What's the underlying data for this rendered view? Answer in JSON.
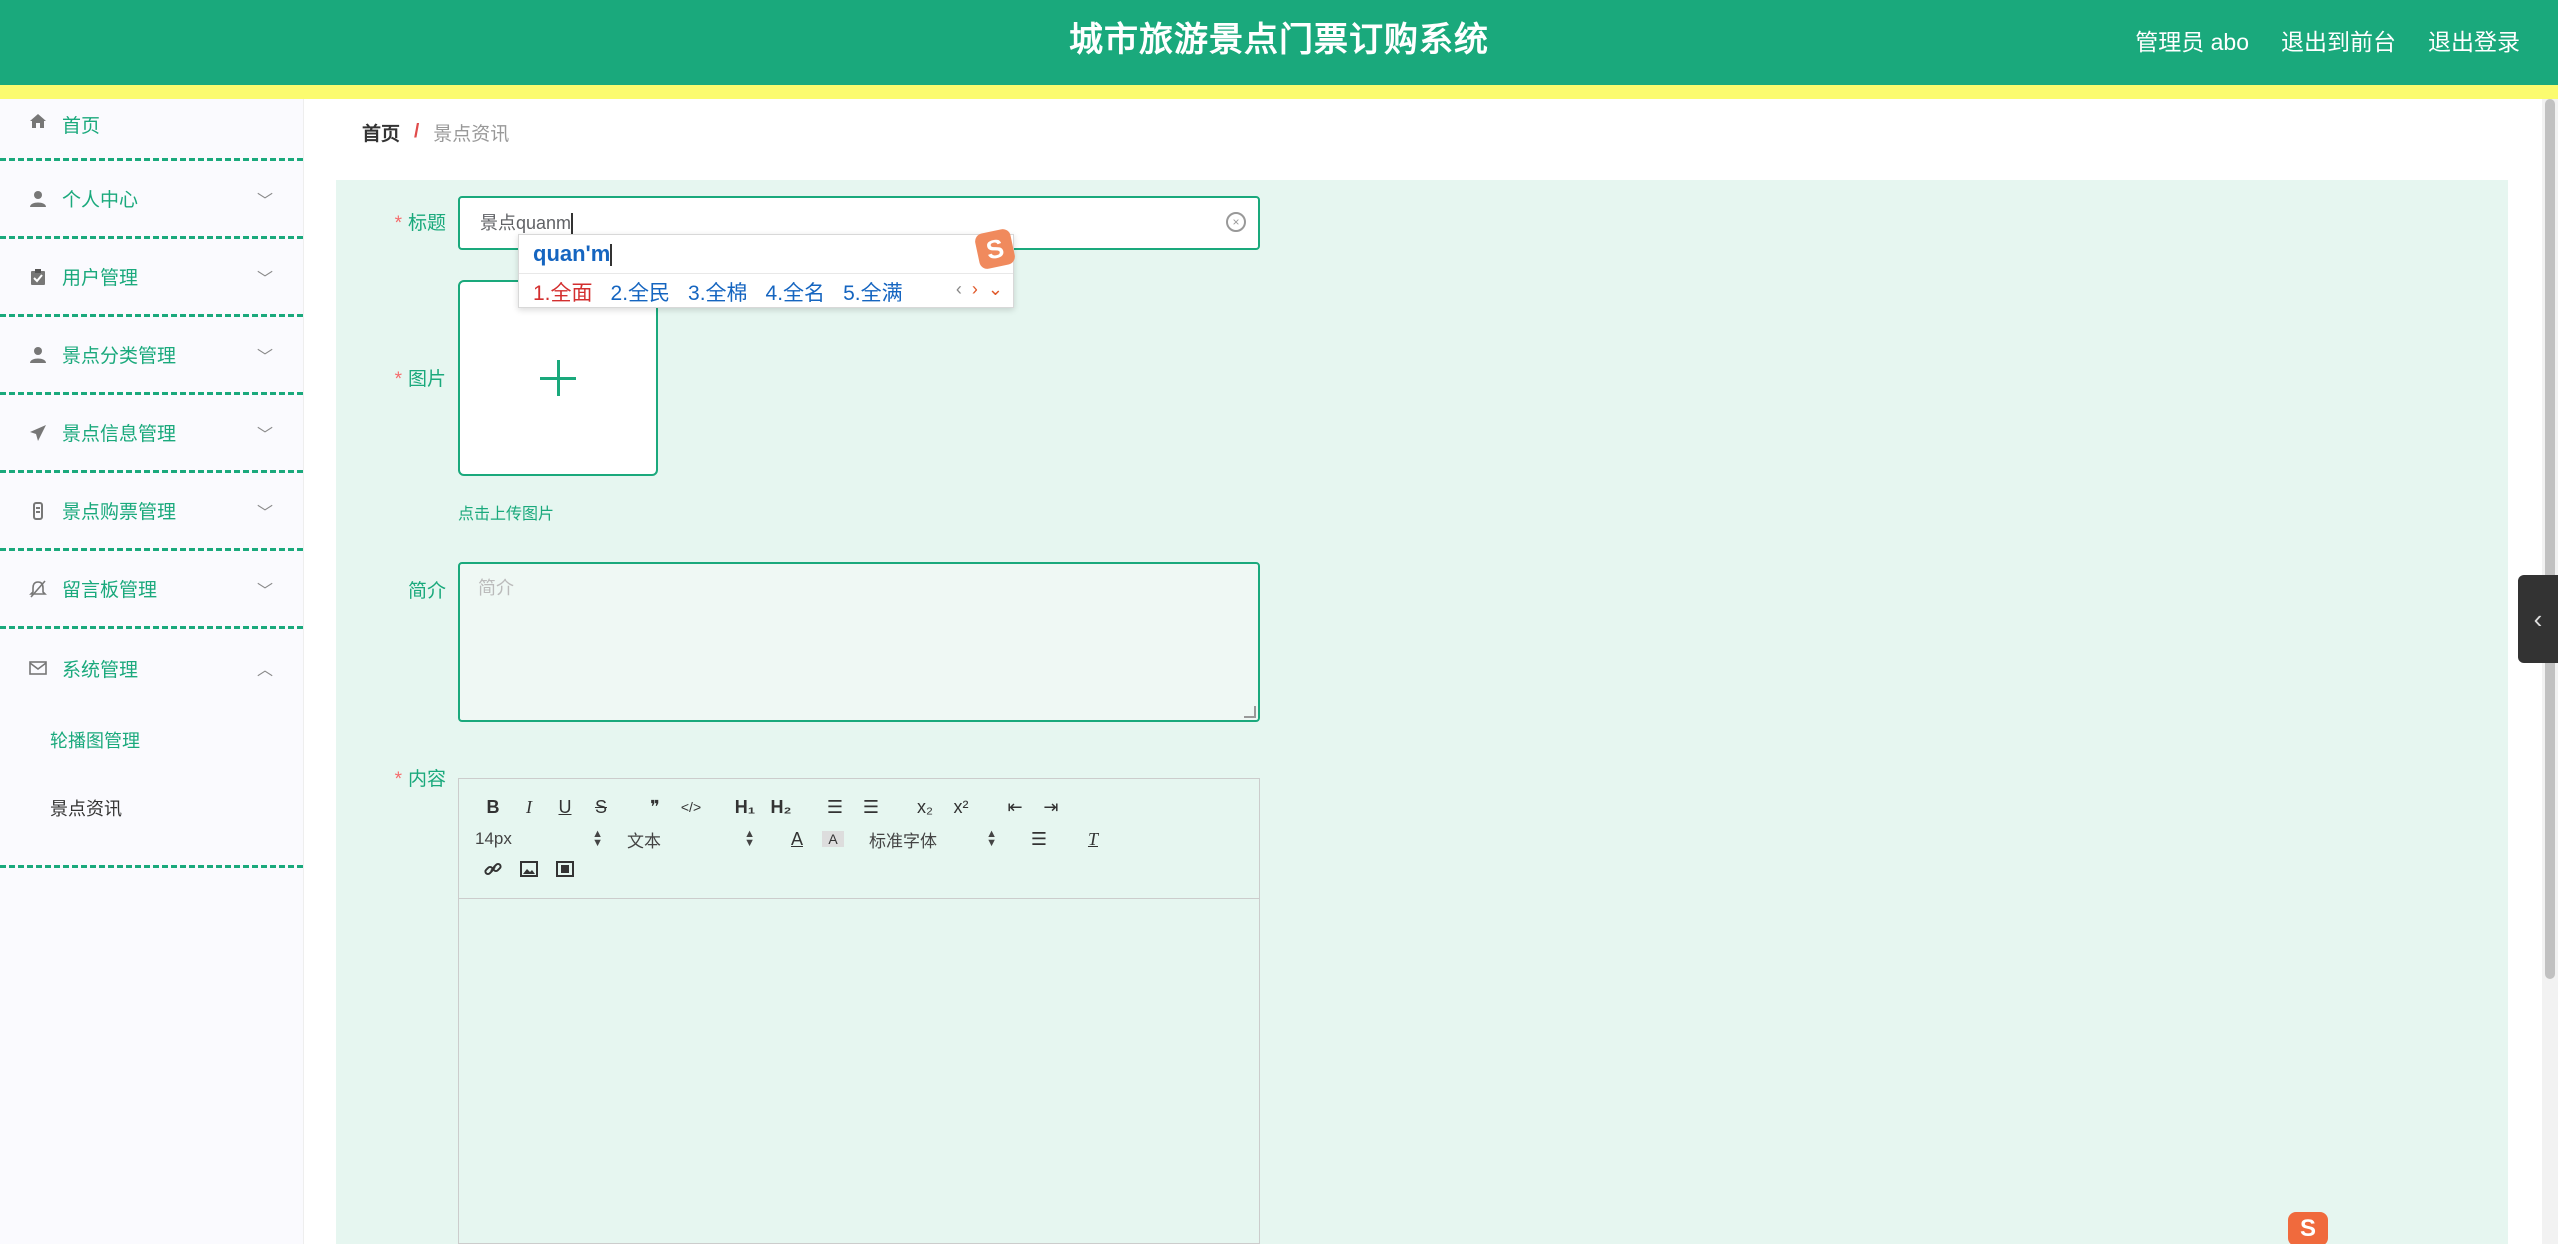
{
  "header": {
    "title": "城市旅游景点门票订购系统",
    "user_label": "管理员 abo",
    "to_front": "退出到前台",
    "logout": "退出登录"
  },
  "sidebar": {
    "items": [
      {
        "label": "首页",
        "icon": "home-icon"
      },
      {
        "label": "个人中心",
        "icon": "user-icon"
      },
      {
        "label": "用户管理",
        "icon": "clipboard-icon"
      },
      {
        "label": "景点分类管理",
        "icon": "person-icon"
      },
      {
        "label": "景点信息管理",
        "icon": "paper-plane-icon"
      },
      {
        "label": "景点购票管理",
        "icon": "ticket-icon"
      },
      {
        "label": "留言板管理",
        "icon": "bell-off-icon"
      },
      {
        "label": "系统管理",
        "icon": "mail-icon"
      }
    ],
    "sub_items": [
      "轮播图管理",
      "景点资讯"
    ]
  },
  "breadcrumb": {
    "home": "首页",
    "separator": "/",
    "current": "景点资讯"
  },
  "form": {
    "title_label": "标题",
    "title_value": "景点quanm",
    "image_label": "图片",
    "upload_hint": "点击上传图片",
    "intro_label": "简介",
    "intro_placeholder": "简介",
    "content_label": "内容"
  },
  "editor": {
    "buttons_row1": [
      "B",
      "I",
      "U",
      "S",
      "❞",
      "</>",
      "H₁",
      "H₂",
      "☰",
      "☰",
      "x₂",
      "x²",
      "⇤",
      "⇥"
    ],
    "font_size": "14px",
    "block_type": "文本",
    "font_family": "标准字体"
  },
  "ime": {
    "composition": "quan'm",
    "candidates": [
      "1.全面",
      "2.全民",
      "3.全棉",
      "4.全名",
      "5.全满"
    ],
    "logo": "S"
  },
  "colors": {
    "primary": "#1aa97c",
    "accent_strip": "#fbfb6f",
    "form_bg": "#e6f6f0"
  }
}
